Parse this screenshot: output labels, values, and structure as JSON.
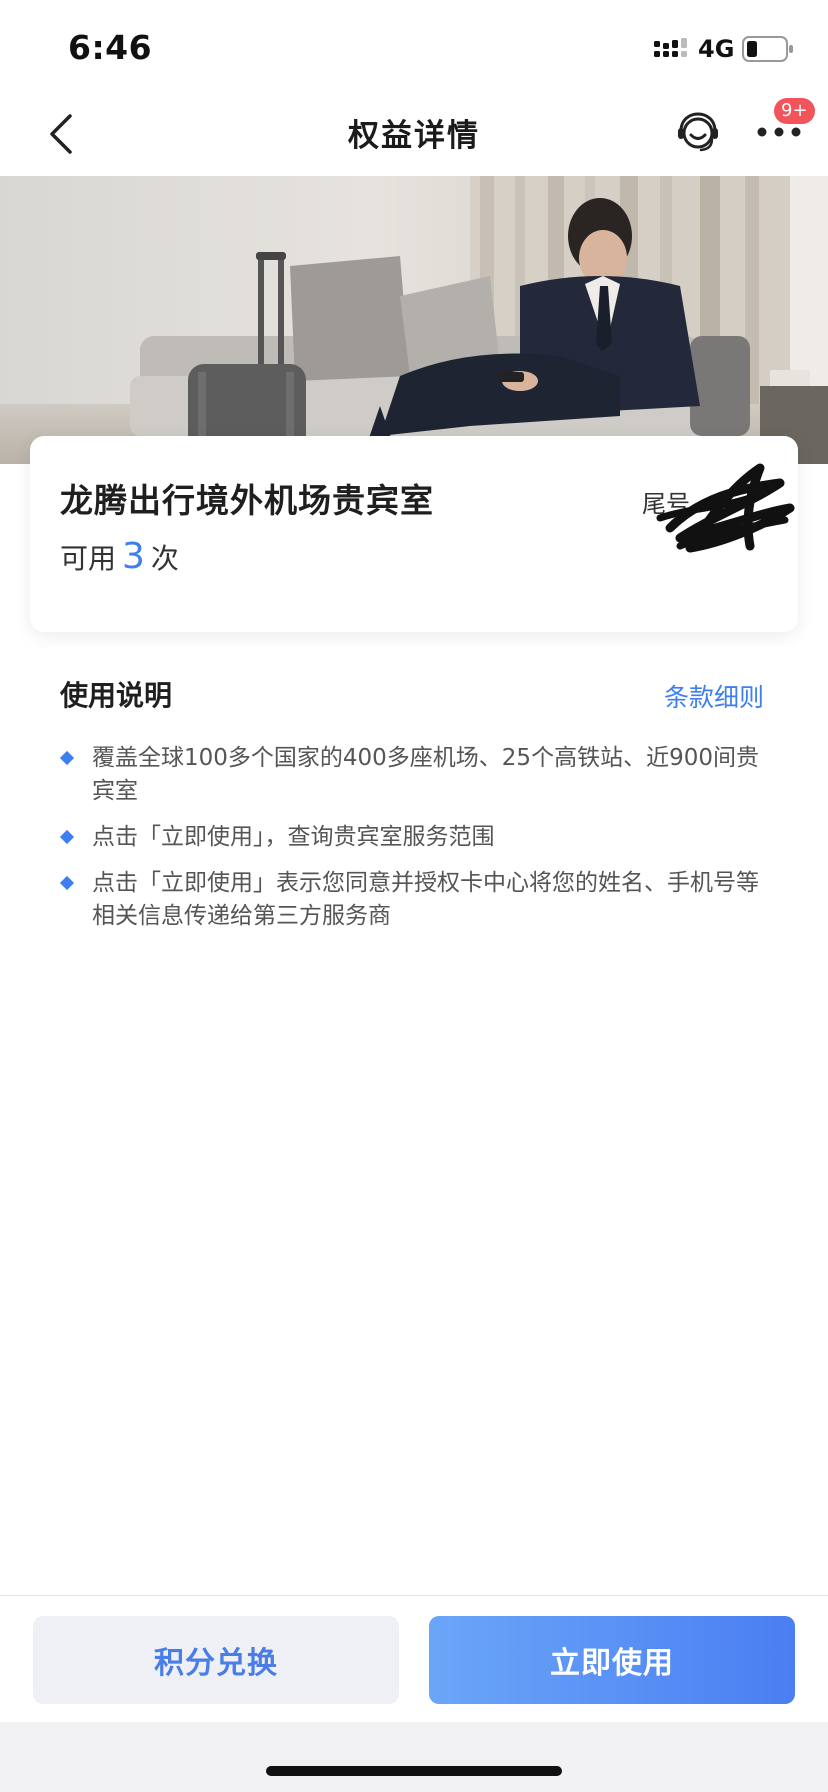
{
  "status_bar": {
    "time": "6:46",
    "network": "4G"
  },
  "nav": {
    "title": "权益详情",
    "badge": "9+"
  },
  "card": {
    "title": "龙腾出行境外机场贵宾室",
    "count_prefix": "可用",
    "count": "3",
    "count_suffix": "次",
    "tail_label": "尾号"
  },
  "instructions": {
    "title": "使用说明",
    "terms_link": "条款细则",
    "items": [
      "覆盖全球100多个国家的400多座机场、25个高铁站、近900间贵宾室",
      "点击「立即使用」，查询贵宾室服务范围",
      "点击「立即使用」表示您同意并授权卡中心将您的姓名、手机号等相关信息传递给第三方服务商"
    ]
  },
  "buttons": {
    "redeem": "积分兑换",
    "use_now": "立即使用"
  },
  "colors": {
    "accent": "#3d7ff0",
    "badge": "#f2545b",
    "secondary_button_bg": "#eef0f6"
  },
  "icons": {
    "back": "chevron-left-icon",
    "service": "customer-service-icon",
    "more": "more-dots-icon",
    "bullet": "diamond-bullet-icon"
  }
}
